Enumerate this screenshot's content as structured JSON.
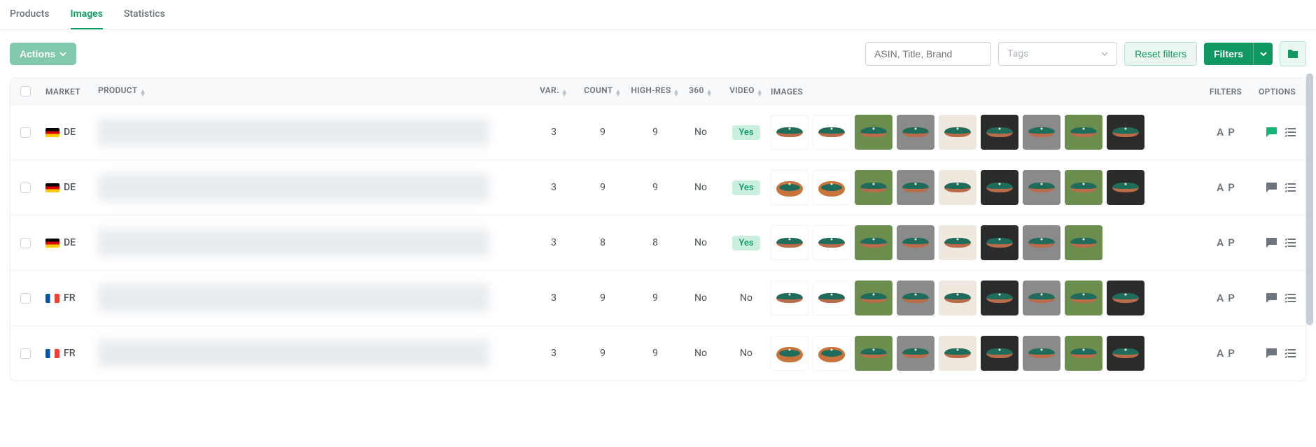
{
  "tabs": {
    "products": "Products",
    "images": "Images",
    "statistics": "Statistics"
  },
  "toolbar": {
    "actions": "Actions",
    "search_placeholder": "ASIN, Title, Brand",
    "tags_placeholder": "Tags",
    "reset": "Reset filters",
    "filters": "Filters"
  },
  "headers": {
    "market": "MARKET",
    "product": "PRODUCT",
    "var": "VAR.",
    "count": "COUNT",
    "hires": "HIGH-RES",
    "n360": "360",
    "video": "VIDEO",
    "images": "IMAGES",
    "filters": "FILTERS",
    "options": "OPTIONS"
  },
  "filters_ap": {
    "a": "A",
    "p": "P"
  },
  "rows": [
    {
      "market": "DE",
      "flag": "de",
      "var": "3",
      "count": "9",
      "hires": "9",
      "n360": "No",
      "video": "Yes",
      "video_badge": true,
      "thumbs": 9,
      "chat_active": true
    },
    {
      "market": "DE",
      "flag": "de",
      "var": "3",
      "count": "9",
      "hires": "9",
      "n360": "No",
      "video": "Yes",
      "video_badge": true,
      "thumbs": 9,
      "chat_active": false
    },
    {
      "market": "DE",
      "flag": "de",
      "var": "3",
      "count": "8",
      "hires": "8",
      "n360": "No",
      "video": "Yes",
      "video_badge": true,
      "thumbs": 8,
      "chat_active": false
    },
    {
      "market": "FR",
      "flag": "fr",
      "var": "3",
      "count": "9",
      "hires": "9",
      "n360": "No",
      "video": "No",
      "video_badge": false,
      "thumbs": 9,
      "chat_active": false
    },
    {
      "market": "FR",
      "flag": "fr",
      "var": "3",
      "count": "9",
      "hires": "9",
      "n360": "No",
      "video": "No",
      "video_badge": false,
      "thumbs": 9,
      "chat_active": false
    }
  ]
}
